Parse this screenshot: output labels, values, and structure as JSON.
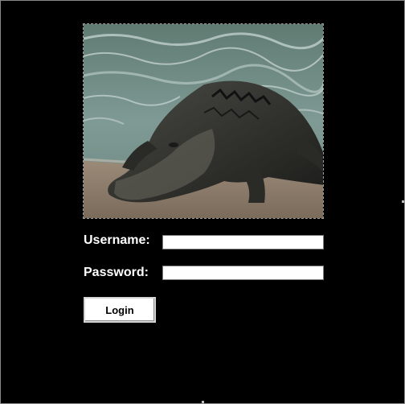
{
  "login_form": {
    "photo_subject": "alligator",
    "username_label": "Username:",
    "username_value": "",
    "password_label": "Password:",
    "password_value": "",
    "login_button_label": "Login"
  },
  "colors": {
    "background": "#000000",
    "label_text": "#ffffff",
    "field_background": "#ffffff"
  }
}
